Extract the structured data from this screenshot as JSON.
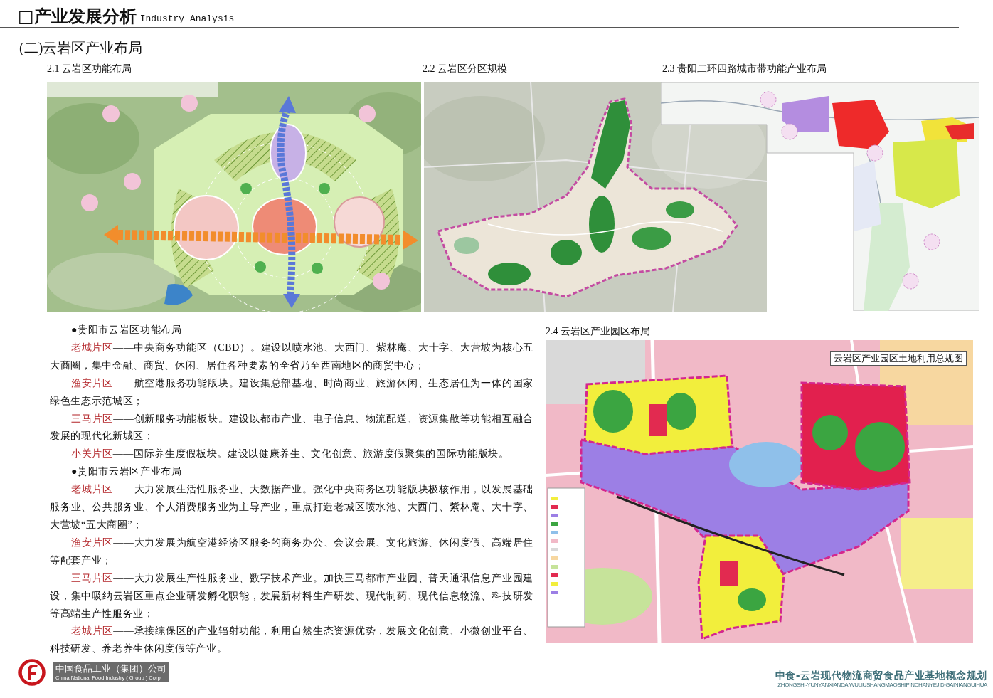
{
  "header": {
    "title": "□产业发展分析",
    "subtitle": "Industry Analysis"
  },
  "section_title": "(二)云岩区产业布局",
  "figures": [
    {
      "caption": "2.1 云岩区功能布局"
    },
    {
      "caption": "2.2 云岩区分区规模"
    },
    {
      "caption": "2.3 贵阳二环四路城市带功能产业布局"
    },
    {
      "caption": "2.4 云岩区产业园区布局",
      "map_title": "云岩区产业园区土地利用总规图"
    }
  ],
  "text_blocks": [
    {
      "kind": "heading",
      "text": "●贵阳市云岩区功能布局"
    },
    {
      "kind": "paragraph",
      "label": "老城片区",
      "text": "——中央商务功能区（CBD）。建设以喷水池、大西门、紫林庵、大十字、大营坡为核心五大商圈，集中金融、商贸、休闲、居住各种要素的全省乃至西南地区的商贸中心；"
    },
    {
      "kind": "paragraph",
      "label": "渔安片区",
      "text": "——航空港服务功能版块。建设集总部基地、时尚商业、旅游休闲、生态居住为一体的国家绿色生态示范城区；"
    },
    {
      "kind": "paragraph",
      "label": "三马片区",
      "text": "——创新服务功能板块。建设以都市产业、电子信息、物流配送、资源集散等功能相互融合发展的现代化新城区；"
    },
    {
      "kind": "paragraph",
      "label": "小关片区",
      "text": "——国际养生度假板块。建设以健康养生、文化创意、旅游度假聚集的国际功能版块。"
    },
    {
      "kind": "heading",
      "text": "●贵阳市云岩区产业布局"
    },
    {
      "kind": "paragraph",
      "label": "老城片区",
      "text": "——大力发展生活性服务业、大数据产业。强化中央商务区功能版块极核作用，以发展基础服务业、公共服务业、个人消费服务业为主导产业，重点打造老城区喷水池、大西门、紫林庵、大十字、大营坡“五大商圈”；"
    },
    {
      "kind": "paragraph",
      "label": "渔安片区",
      "text": "——大力发展为航空港经济区服务的商务办公、会议会展、文化旅游、休闲度假、高端居住等配套产业；"
    },
    {
      "kind": "paragraph",
      "label": "三马片区",
      "text": "——大力发展生产性服务业、数字技术产业。加快三马都市产业园、普天通讯信息产业园建设，集中吸纳云岩区重点企业研发孵化职能，发展新材料生产研发、现代制药、现代信息物流、科技研发等高端生产性服务业；"
    },
    {
      "kind": "paragraph",
      "label": "老城片区",
      "text": "——承接综保区的产业辐射功能，利用自然生态资源优势，发展文化创意、小微创业平台、科技研发、养老养生休闲度假等产业。"
    }
  ],
  "footer": {
    "company_cn": "中国食品工业（集团）公司",
    "company_en": "China National Food Industry ( Group ) Corp",
    "project_title": "中食-云岩现代物流商贸食品产业基地概念规划",
    "project_pinyin": "ZHONGSHI-YUNYANXIANDAIWULIUSHANGMAOSHIPINCHANYEJIDIGAINIANGUIHUA"
  }
}
